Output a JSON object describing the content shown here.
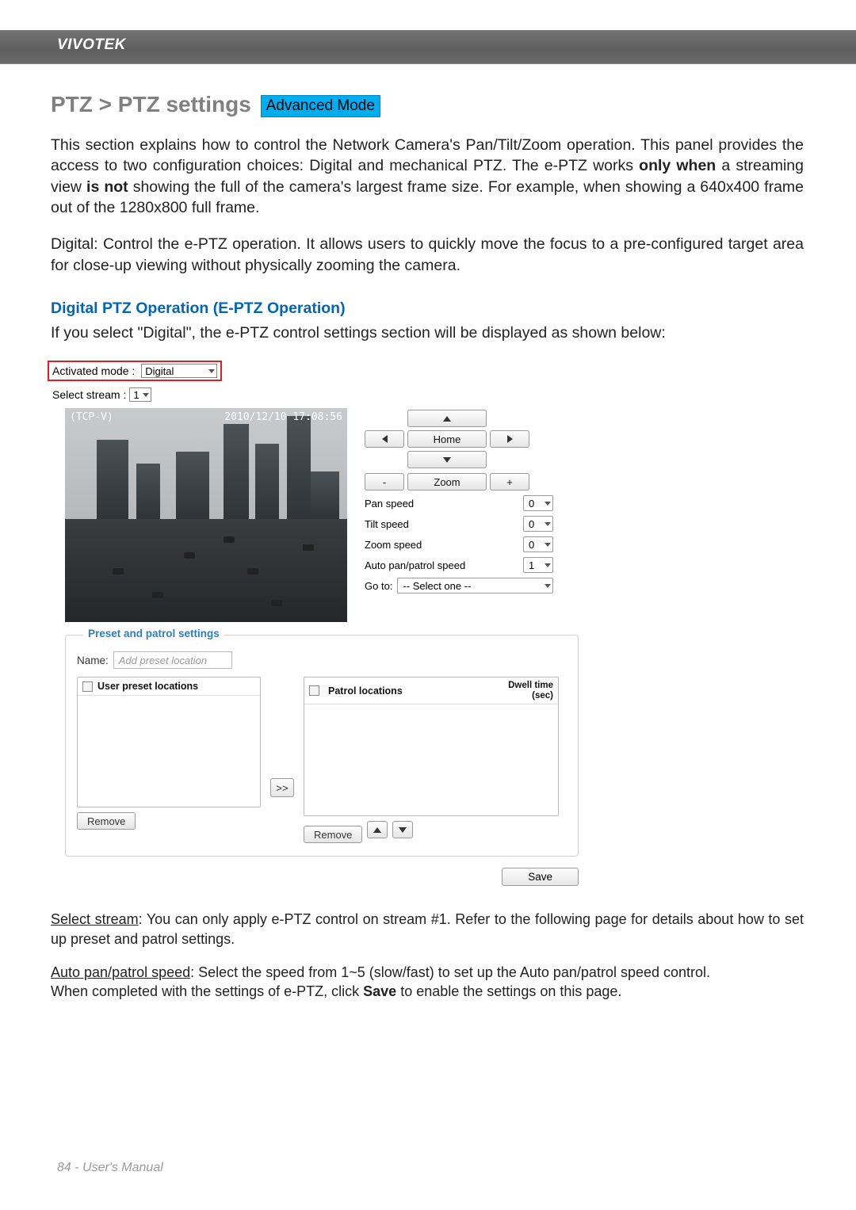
{
  "brand": "VIVOTEK",
  "breadcrumb": {
    "title": "PTZ > PTZ settings",
    "badge": "Advanced Mode"
  },
  "intro": {
    "p1_a": "This section explains how to control the Network Camera's Pan/Tilt/Zoom operation. This panel provides the access to two configuration choices: Digital and mechanical PTZ. The e-PTZ works ",
    "p1_bold": "only when",
    "p1_b": " a streaming view ",
    "p1_bold2": "is not",
    "p1_c": " showing the full of the camera's largest frame size. For example, when showing a 640x400 frame out of the 1280x800 full frame.",
    "p2": "Digital: Control the e-PTZ operation. It allows users to quickly move the focus to a pre-configured target area for close-up viewing without physically zooming the camera."
  },
  "section1": {
    "heading": "Digital PTZ Operation (E-PTZ Operation)",
    "lead": "If you select \"Digital\", the e-PTZ control settings section will be displayed as shown below:"
  },
  "activated_mode": {
    "label": "Activated mode :",
    "value": "Digital"
  },
  "select_stream": {
    "label": "Select stream :",
    "value": "1"
  },
  "video_overlay": {
    "left": "(TCP-V)",
    "right": "2010/12/10  17:08:56"
  },
  "ptz": {
    "home": "Home",
    "zoom_label": "Zoom",
    "zoom_minus": "-",
    "zoom_plus": "+",
    "pan_speed_label": "Pan speed",
    "tilt_speed_label": "Tilt speed",
    "zoom_speed_label": "Zoom speed",
    "auto_speed_label": "Auto pan/patrol speed",
    "goto_label": "Go to:",
    "goto_value": "-- Select one --",
    "pan_speed": "0",
    "tilt_speed": "0",
    "zoom_speed": "0",
    "auto_speed": "1"
  },
  "preset": {
    "legend": "Preset and patrol settings",
    "name_label": "Name:",
    "name_placeholder": "Add preset location",
    "user_col": "User preset locations",
    "patrol_col": "Patrol locations",
    "dwell_head1": "Dwell time",
    "dwell_head2": "(sec)",
    "move_right": ">>",
    "remove": "Remove"
  },
  "save": "Save",
  "select_stream_para_a": "Select stream",
  "select_stream_para_b": ": You can only apply e-PTZ control on stream #1. Refer to the following page for details about how to set up preset and patrol settings.",
  "auto_para_a": "Auto pan/patrol speed",
  "auto_para_b": ": Select the speed from 1~5 (slow/fast) to set up the Auto pan/patrol speed control.",
  "auto_para_c_a": "When completed with the settings of e-PTZ, click ",
  "auto_para_c_bold": "Save",
  "auto_para_c_b": " to enable the settings on this page.",
  "footer": "84 - User's Manual"
}
